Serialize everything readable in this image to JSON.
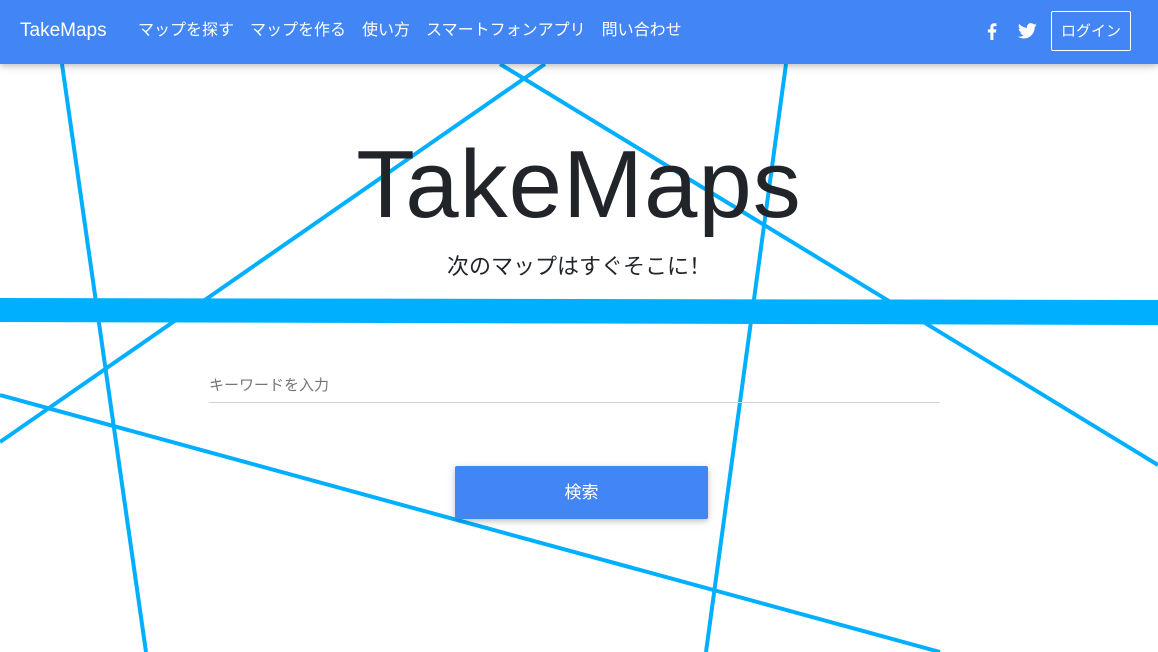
{
  "colors": {
    "navbar": "#4285f4",
    "accent_lines": "#00b0ff",
    "title_text": "#212529",
    "button": "#4285f4"
  },
  "navbar": {
    "brand": "TakeMaps",
    "links": [
      {
        "label": "マップを探す"
      },
      {
        "label": "マップを作る"
      },
      {
        "label": "使い方"
      },
      {
        "label": "スマートフォンアプリ"
      },
      {
        "label": "問い合わせ"
      }
    ],
    "social_icons": [
      "facebook-icon",
      "twitter-icon"
    ],
    "login_label": "ログイン"
  },
  "hero": {
    "title": "TakeMaps",
    "subtitle": "次のマップはすぐそこに！"
  },
  "search": {
    "placeholder": "キーワードを入力",
    "value": "",
    "button_label": "検索"
  }
}
